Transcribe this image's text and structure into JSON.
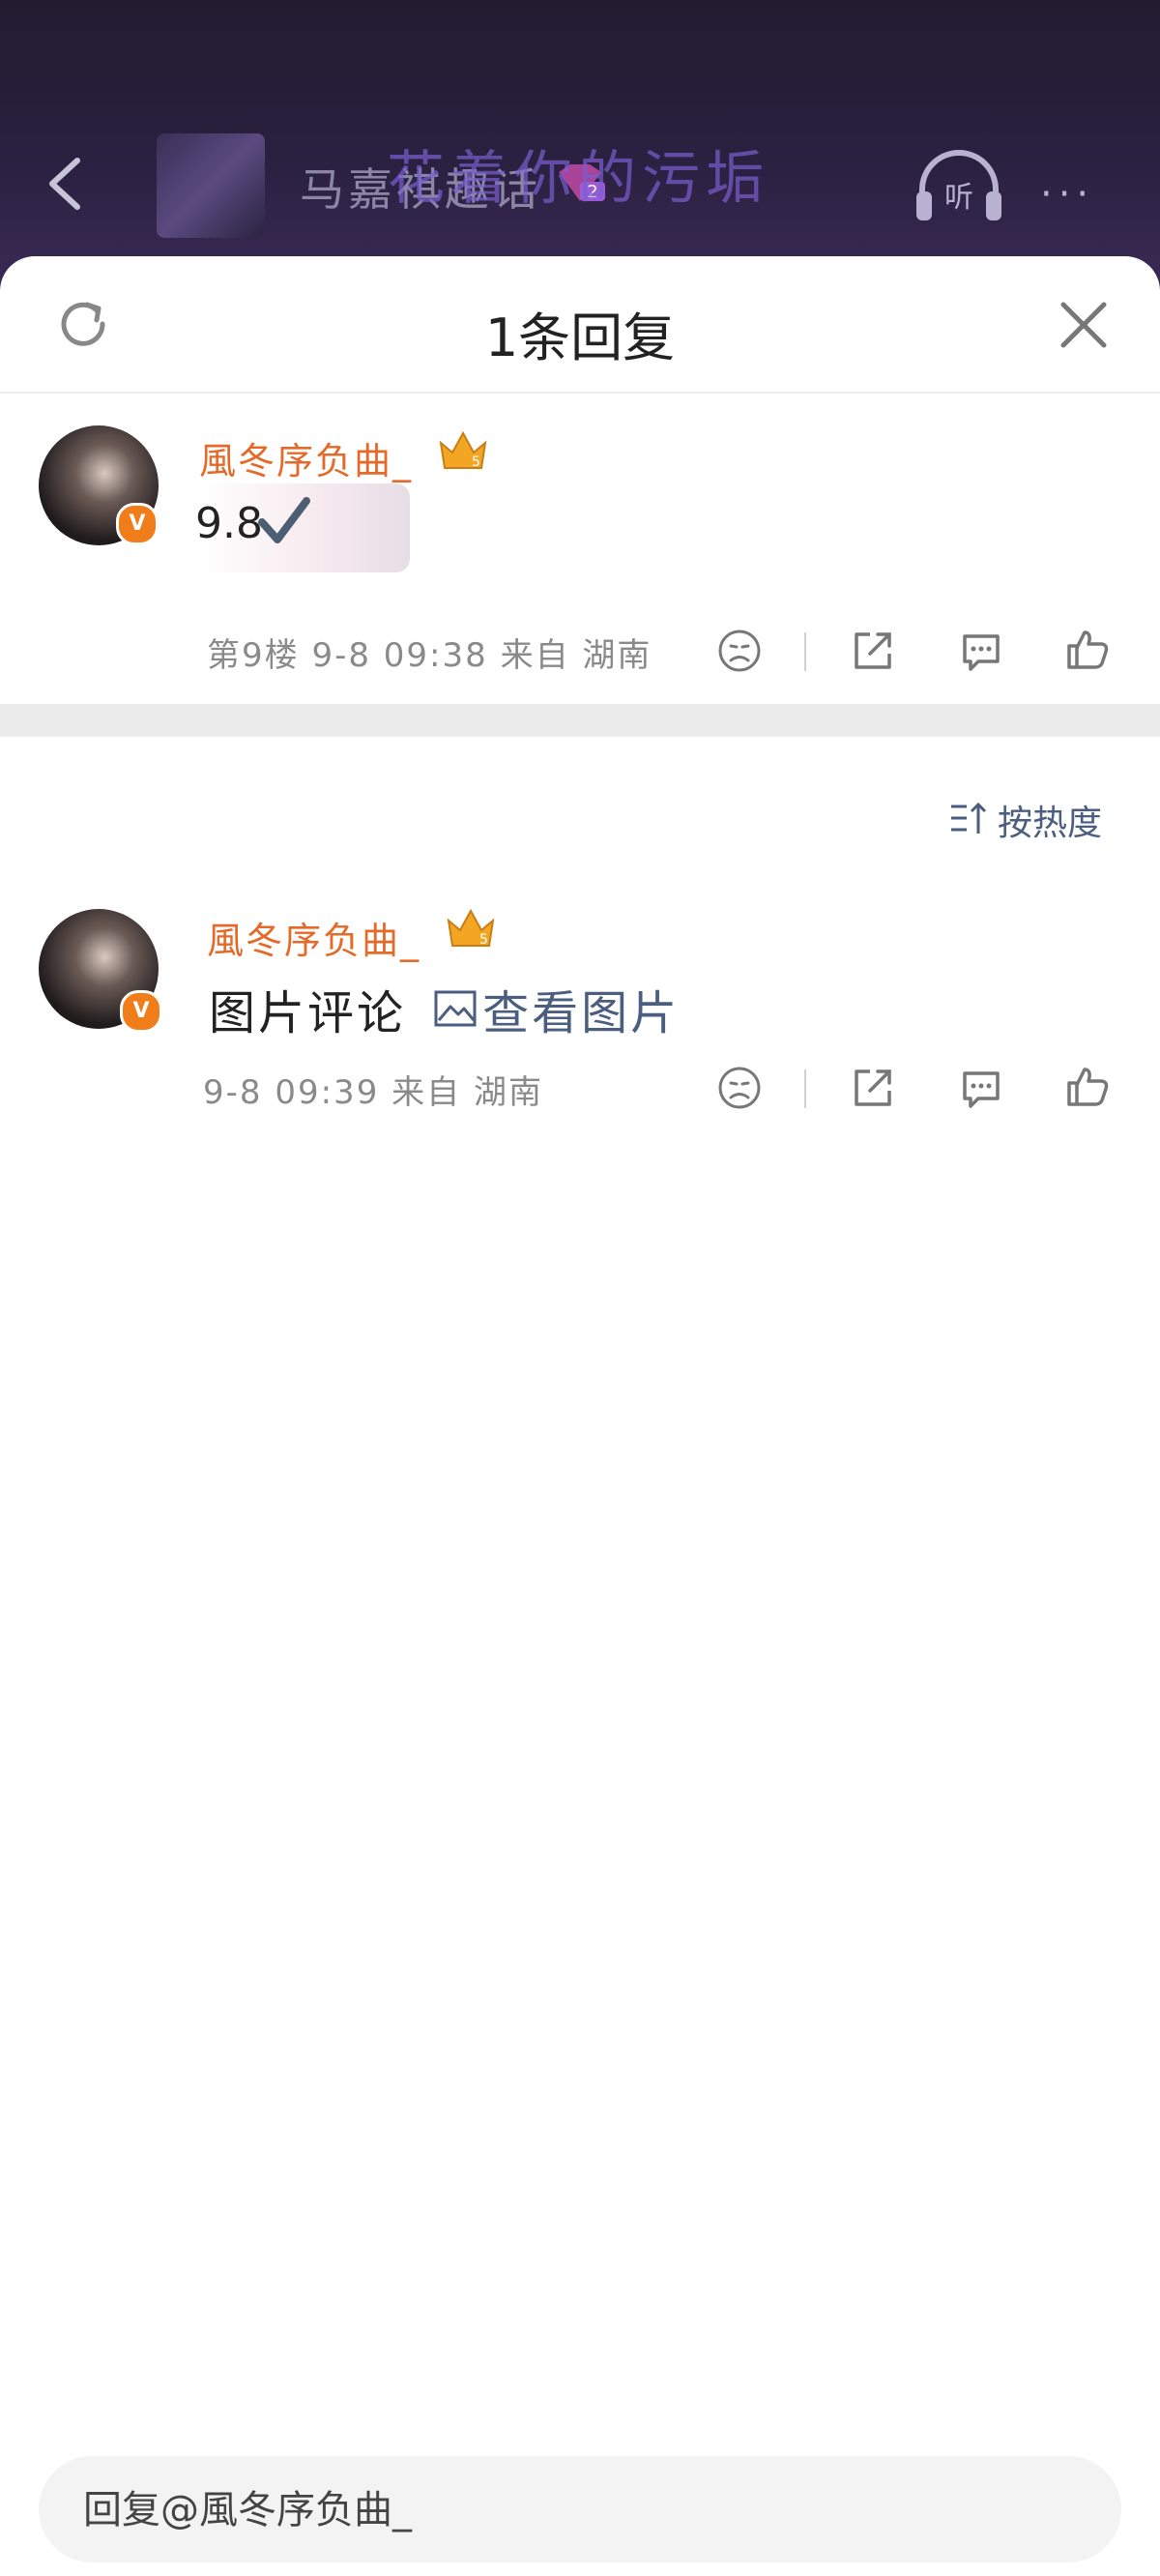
{
  "topbar": {
    "title": "马嘉祺趣话",
    "level": "2",
    "overlay_text": "花着你的污垢",
    "listen_label": "听",
    "more_label": "···",
    "accent": "#7a5fd0"
  },
  "sheet": {
    "title": "1条回复"
  },
  "original_comment": {
    "username": "風冬序负曲_",
    "crown_level": "5",
    "text": "9.8",
    "floor": "第9楼",
    "time": "9-8 09:38",
    "location": "来自 湖南"
  },
  "sort": {
    "label": "按热度"
  },
  "reply": {
    "username": "風冬序负曲_",
    "crown_level": "5",
    "text": "图片评论",
    "view_image_label": "查看图片",
    "time": "9-8 09:39",
    "location": "来自 湖南"
  },
  "reply_input": {
    "placeholder": "回复@風冬序负曲_"
  },
  "colors": {
    "username": "#e46a2a",
    "link": "#4b5e80",
    "badge": "#f07d1a"
  }
}
